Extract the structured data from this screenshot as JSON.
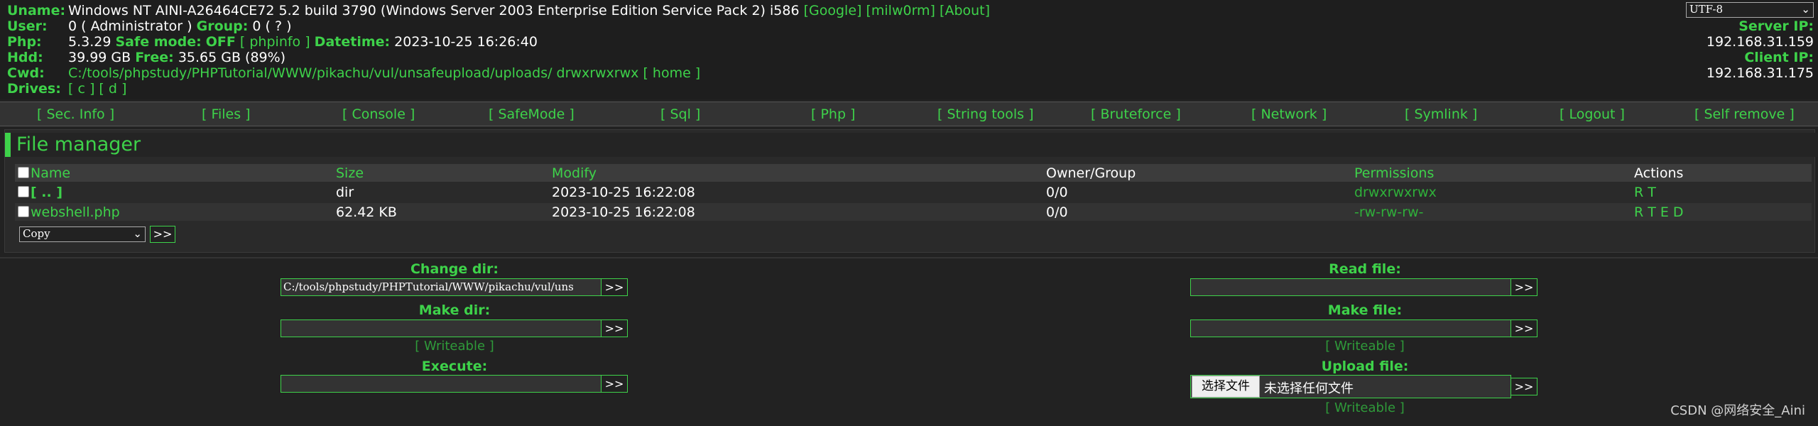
{
  "header": {
    "uname_label": "Uname:",
    "uname_value": "Windows NT AINI-A26464CE72 5.2 build 3790 (Windows Server 2003 Enterprise Edition Service Pack 2) i586",
    "uname_links": [
      "[Google]",
      "[milw0rm]",
      "[About]"
    ],
    "user_label": "User:",
    "user_value": "0 ( Administrator )",
    "group_label": "Group:",
    "group_value": "0 ( ? )",
    "php_label": "Php:",
    "php_version": "5.3.29",
    "safe_mode_label": "Safe mode:",
    "safe_mode_value": "OFF",
    "phpinfo_link": "[ phpinfo ]",
    "datetime_label": "Datetime:",
    "datetime_value": "2023-10-25 16:26:40",
    "hdd_label": "Hdd:",
    "hdd_value": "39.99 GB",
    "free_label": "Free:",
    "free_value": "35.65 GB (89%)",
    "cwd_label": "Cwd:",
    "cwd_value": "C:/tools/phpstudy/PHPTutorial/WWW/pikachu/vul/unsafeupload/uploads/",
    "cwd_perms": "drwxrwxrwx",
    "home_link": "[ home ]",
    "drives_label": "Drives:",
    "drives": [
      "[ c ]",
      "[ d ]"
    ],
    "charset_selected": "UTF-8",
    "server_ip_label": "Server IP:",
    "server_ip": "192.168.31.159",
    "client_ip_label": "Client IP:",
    "client_ip": "192.168.31.175"
  },
  "menu": [
    "[ Sec. Info ]",
    "[ Files ]",
    "[ Console ]",
    "[ SafeMode ]",
    "[ Sql ]",
    "[ Php ]",
    "[ String tools ]",
    "[ Bruteforce ]",
    "[ Network ]",
    "[ Symlink ]",
    "[ Logout ]",
    "[ Self remove ]"
  ],
  "file_manager": {
    "title": "File manager",
    "columns": [
      "Name",
      "Size",
      "Modify",
      "Owner/Group",
      "Permissions",
      "Actions"
    ],
    "rows": [
      {
        "name": "[ .. ]",
        "size": "dir",
        "modify": "2023-10-25 16:22:08",
        "owner": "0/0",
        "perms": "drwxrwxrwx",
        "actions": "R T"
      },
      {
        "name": "webshell.php",
        "size": "62.42 KB",
        "modify": "2023-10-25 16:22:08",
        "owner": "0/0",
        "perms": "-rw-rw-rw-",
        "actions": "R T E D"
      }
    ],
    "action_selected": "Copy",
    "go_label": ">>"
  },
  "tools": {
    "change_dir_label": "Change dir:",
    "change_dir_value": "C:/tools/phpstudy/PHPTutorial/WWW/pikachu/vul/uns",
    "make_dir_label": "Make dir:",
    "writeable": "[ Writeable ]",
    "execute_label": "Execute:",
    "read_file_label": "Read file:",
    "make_file_label": "Make file:",
    "upload_label": "Upload file:",
    "upload_button": "选择文件",
    "upload_status": "未选择任何文件",
    "go_label": ">>"
  },
  "watermark": "CSDN @网络安全_Aini",
  "colors": {
    "accent": "#3ed24a",
    "background": "#222222"
  }
}
